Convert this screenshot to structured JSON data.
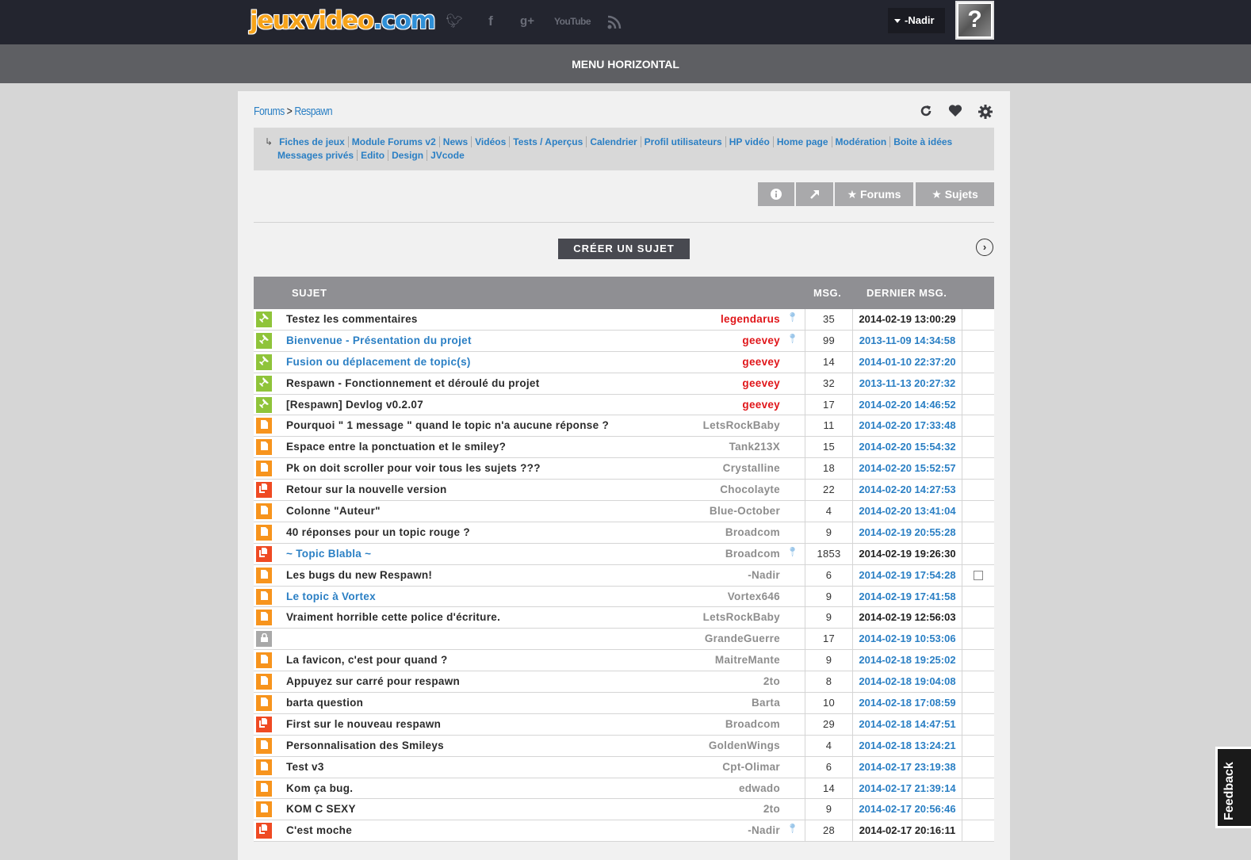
{
  "header": {
    "logo_part1": "jeuxvideo",
    "logo_part2": ".com",
    "social": [
      "twitter-icon",
      "facebook-icon",
      "google-plus-icon",
      "youtube-icon",
      "rss-icon"
    ],
    "youtube_label": "YouTube",
    "user_name": "-Nadir",
    "avatar_glyph": "?"
  },
  "menu": {
    "label": "MENU HORIZONTAL"
  },
  "breadcrumb": {
    "root": "Forums",
    "separator": ">",
    "current": "Respawn"
  },
  "subnav": {
    "line1": [
      "Fiches de jeux",
      "Module Forums v2",
      "News",
      "Vidéos",
      "Tests / Aperçus",
      "Calendrier",
      "Profil utilisateurs",
      "HP vidéo",
      "Home page",
      "Modération",
      "Boite à idées"
    ],
    "line2": [
      "Messages privés",
      "Edito",
      "Design",
      "JVcode"
    ]
  },
  "buttons": {
    "forums": "Forums",
    "sujets": "Sujets",
    "create": "CRÉER UN SUJET"
  },
  "table": {
    "headers": {
      "subject": "SUJET",
      "msg": "MSG.",
      "last": "DERNIER MSG."
    },
    "rows": [
      {
        "icon": "pin",
        "title": "Testez les commentaires",
        "blue": false,
        "author": "legendarus",
        "admin": true,
        "marker": true,
        "msg": "35",
        "date": "2014-02-19 13:00:29",
        "date_black": true
      },
      {
        "icon": "pin",
        "title": "Bienvenue - Présentation du projet",
        "blue": true,
        "author": "geevey",
        "admin": true,
        "marker": true,
        "msg": "99",
        "date": "2013-11-09 14:34:58",
        "date_black": false
      },
      {
        "icon": "pin",
        "title": "Fusion ou déplacement de topic(s)",
        "blue": true,
        "author": "geevey",
        "admin": true,
        "marker": false,
        "msg": "14",
        "date": "2014-01-10 22:37:20",
        "date_black": false
      },
      {
        "icon": "pin",
        "title": "Respawn - Fonctionnement et déroulé du projet",
        "blue": false,
        "author": "geevey",
        "admin": true,
        "marker": false,
        "msg": "32",
        "date": "2013-11-13 20:27:32",
        "date_black": false
      },
      {
        "icon": "pin",
        "title": "[Respawn] Devlog v0.2.07",
        "blue": false,
        "author": "geevey",
        "admin": true,
        "marker": false,
        "msg": "17",
        "date": "2014-02-20 14:46:52",
        "date_black": false
      },
      {
        "icon": "doc",
        "title": "Pourquoi \" 1 message \" quand le topic n'a aucune réponse ?",
        "blue": false,
        "author": "LetsRockBaby",
        "admin": false,
        "marker": false,
        "msg": "11",
        "date": "2014-02-20 17:33:48",
        "date_black": false
      },
      {
        "icon": "doc",
        "title": "Espace entre la ponctuation et le smiley?",
        "blue": false,
        "author": "Tank213X",
        "admin": false,
        "marker": false,
        "msg": "15",
        "date": "2014-02-20 15:54:32",
        "date_black": false
      },
      {
        "icon": "doc",
        "title": "Pk on doit scroller pour voir tous les sujets ???",
        "blue": false,
        "author": "Crystalline",
        "admin": false,
        "marker": false,
        "msg": "18",
        "date": "2014-02-20 15:52:57",
        "date_black": false
      },
      {
        "icon": "hot",
        "title": "Retour sur la nouvelle version",
        "blue": false,
        "author": "Chocolayte",
        "admin": false,
        "marker": false,
        "msg": "22",
        "date": "2014-02-20 14:27:53",
        "date_black": false
      },
      {
        "icon": "doc",
        "title": "Colonne \"Auteur\"",
        "blue": false,
        "author": "Blue-October",
        "admin": false,
        "marker": false,
        "msg": "4",
        "date": "2014-02-20 13:41:04",
        "date_black": false
      },
      {
        "icon": "doc",
        "title": "40 réponses pour un topic rouge ?",
        "blue": false,
        "author": "Broadcom",
        "admin": false,
        "marker": false,
        "msg": "9",
        "date": "2014-02-19 20:55:28",
        "date_black": false
      },
      {
        "icon": "hot",
        "title": "~ Topic Blabla ~",
        "blue": true,
        "author": "Broadcom",
        "admin": false,
        "marker": true,
        "msg": "1853",
        "date": "2014-02-19 19:26:30",
        "date_black": true
      },
      {
        "icon": "doc",
        "title": "Les bugs du new Respawn!",
        "blue": false,
        "author": "-Nadir",
        "admin": false,
        "marker": false,
        "msg": "6",
        "date": "2014-02-19 17:54:28",
        "date_black": false,
        "checkbox": true
      },
      {
        "icon": "doc",
        "title": "Le topic à Vortex",
        "blue": true,
        "author": "Vortex646",
        "admin": false,
        "marker": false,
        "msg": "9",
        "date": "2014-02-19 17:41:58",
        "date_black": false
      },
      {
        "icon": "doc",
        "title": "Vraiment horrible cette police d'écriture.",
        "blue": false,
        "author": "LetsRockBaby",
        "admin": false,
        "marker": false,
        "msg": "9",
        "date": "2014-02-19 12:56:03",
        "date_black": true
      },
      {
        "icon": "lock",
        "title": "",
        "blue": false,
        "author": "GrandeGuerre",
        "admin": false,
        "marker": false,
        "msg": "17",
        "date": "2014-02-19 10:53:06",
        "date_black": false
      },
      {
        "icon": "doc",
        "title": "La favicon, c'est pour quand ?",
        "blue": false,
        "author": "MaitreMante",
        "admin": false,
        "marker": false,
        "msg": "9",
        "date": "2014-02-18 19:25:02",
        "date_black": false
      },
      {
        "icon": "doc",
        "title": "Appuyez sur carré pour respawn",
        "blue": false,
        "author": "2to",
        "admin": false,
        "marker": false,
        "msg": "8",
        "date": "2014-02-18 19:04:08",
        "date_black": false
      },
      {
        "icon": "doc",
        "title": "barta question",
        "blue": false,
        "author": "Barta",
        "admin": false,
        "marker": false,
        "msg": "10",
        "date": "2014-02-18 17:08:59",
        "date_black": false
      },
      {
        "icon": "hot",
        "title": "First sur le nouveau respawn",
        "blue": false,
        "author": "Broadcom",
        "admin": false,
        "marker": false,
        "msg": "29",
        "date": "2014-02-18 14:47:51",
        "date_black": false
      },
      {
        "icon": "doc",
        "title": "Personnalisation des Smileys",
        "blue": false,
        "author": "GoldenWings",
        "admin": false,
        "marker": false,
        "msg": "4",
        "date": "2014-02-18 13:24:21",
        "date_black": false
      },
      {
        "icon": "doc",
        "title": "Test v3",
        "blue": false,
        "author": "Cpt-Olimar",
        "admin": false,
        "marker": false,
        "msg": "6",
        "date": "2014-02-17 23:19:38",
        "date_black": false
      },
      {
        "icon": "doc",
        "title": "Kom ça bug.",
        "blue": false,
        "author": "edwado",
        "admin": false,
        "marker": false,
        "msg": "14",
        "date": "2014-02-17 21:39:14",
        "date_black": false
      },
      {
        "icon": "doc",
        "title": "KOM C SEXY",
        "blue": false,
        "author": "2to",
        "admin": false,
        "marker": false,
        "msg": "9",
        "date": "2014-02-17 20:56:46",
        "date_black": false
      },
      {
        "icon": "hot",
        "title": "C'est moche",
        "blue": false,
        "author": "-Nadir",
        "admin": false,
        "marker": true,
        "msg": "28",
        "date": "2014-02-17 20:16:11",
        "date_black": true
      }
    ]
  },
  "feedback": {
    "label": "Feedback"
  },
  "colors": {
    "pin": "#8fc43a",
    "doc": "#f7941d",
    "hot": "#ef4a23",
    "lock": "#a9a9a9",
    "link": "#2a7fc4",
    "admin": "#e0161a"
  }
}
